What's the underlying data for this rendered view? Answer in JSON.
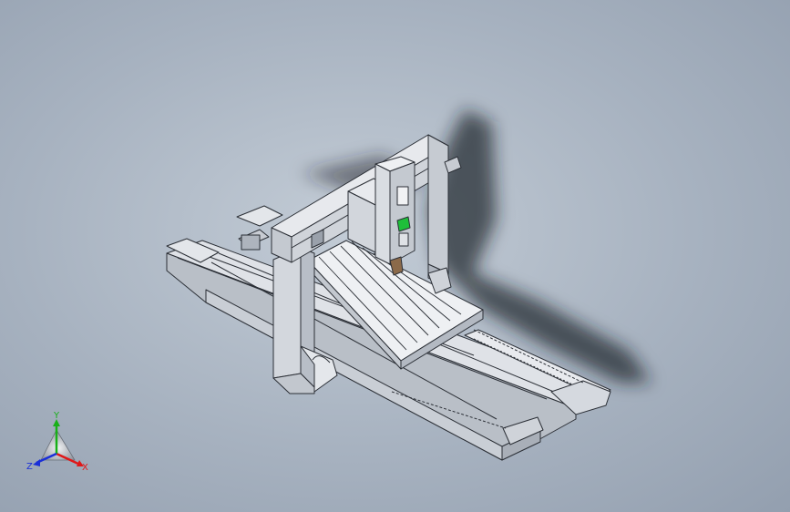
{
  "viewport": {
    "background_top": "#8e9aab",
    "background_bottom": "#c7cfd8",
    "model_face_light": "#eceef1",
    "model_face_mid": "#d6dae0",
    "model_face_dark": "#b7bdc6",
    "model_edge": "#2b2f36",
    "accent_green": "#1fbf3a",
    "accent_brown": "#8b6a4a"
  },
  "triad": {
    "x_label": "X",
    "y_label": "Y",
    "z_label": "Z",
    "x_color": "#e01818",
    "y_color": "#18b018",
    "z_color": "#1a2fd8"
  }
}
